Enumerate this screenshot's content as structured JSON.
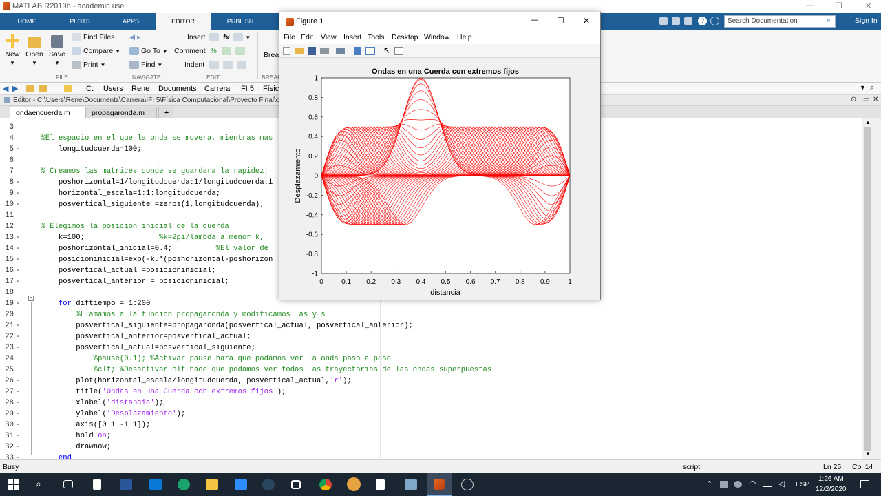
{
  "app": {
    "window_title": "MATLAB R2019b - academic use",
    "tabs": [
      "HOME",
      "PLOTS",
      "APPS",
      "EDITOR",
      "PUBLISH"
    ],
    "active_tab": "EDITOR",
    "search_placeholder": "Search Documentation",
    "sign_in": "Sign In"
  },
  "ribbon": {
    "file": {
      "new": "New",
      "open": "Open",
      "save": "Save",
      "find_files": "Find Files",
      "compare": "Compare",
      "print": "Print",
      "group": "FILE"
    },
    "navigate": {
      "go_to": "Go To",
      "find": "Find",
      "group": "NAVIGATE"
    },
    "edit": {
      "insert": "Insert",
      "comment": "Comment",
      "indent": "Indent",
      "group": "EDIT"
    },
    "breakpoints": {
      "label": "Break",
      "group": "BREAK"
    }
  },
  "address": {
    "parts": [
      "C:",
      "Users",
      "Rene",
      "Documents",
      "Carrera",
      "IFI 5",
      "Física"
    ]
  },
  "editor": {
    "path": "Editor - C:\\Users\\Rene\\Documents\\Carrera\\IFI 5\\Física Computacional\\Proyecto Final\\on",
    "files": [
      "ondaencuerda.m",
      "propagaronda.m"
    ],
    "lines": [
      {
        "n": "3",
        "t": ""
      },
      {
        "n": "4",
        "t": "    %El espacio en el que la onda se movera, mientras mas"
      },
      {
        "n": "5",
        "t": "        longitudcuerda=100;"
      },
      {
        "n": "6",
        "t": ""
      },
      {
        "n": "7",
        "t": "    % Creamos las matrices donde se guardara la rapidez;"
      },
      {
        "n": "8",
        "t": "        poshorizontal=1/longitudcuerda:1/longitudcuerda:1"
      },
      {
        "n": "9",
        "t": "        horizontal_escala=1:1:longitudcuerda;"
      },
      {
        "n": "10",
        "t": "        posvertical_siguiente =zeros(1,longitudcuerda);"
      },
      {
        "n": "11",
        "t": ""
      },
      {
        "n": "12",
        "t": "    % Elegimos la posicion inicial de la cuerda"
      },
      {
        "n": "13",
        "t": "        k=100;                 %k=2pi/lambda a menor k,"
      },
      {
        "n": "14",
        "t": "        poshorizontal_inicial=0.4;          %El valor de"
      },
      {
        "n": "15",
        "t": "        posicioninicial=exp(-k.*(poshorizontal-poshorizon"
      },
      {
        "n": "16",
        "t": "        posvertical_actual =posicioninicial;"
      },
      {
        "n": "17",
        "t": "        posvertical_anterior = posicioninicial;"
      },
      {
        "n": "18",
        "t": ""
      },
      {
        "n": "19",
        "t": "        for diftiempo = 1:200"
      },
      {
        "n": "20",
        "t": "            %Llamamos a la funcion propagaronda y modificamos las y s"
      },
      {
        "n": "21",
        "t": "            posvertical_siguiente=propagaronda(posvertical_actual, posvertical_anterior);"
      },
      {
        "n": "22",
        "t": "            posvertical_anterior=posvertical_actual;"
      },
      {
        "n": "23",
        "t": "            posvertical_actual=posvertical_siguiente;"
      },
      {
        "n": "24",
        "t": "                %pause(0.1); %Activar pause hara que podamos ver la onda paso a paso"
      },
      {
        "n": "25",
        "t": "                %clf; %Desactivar clf hace que podamos ver todas las trayectorias de las ondas superpuestas"
      },
      {
        "n": "26",
        "t": "            plot(horizontal_escala/longitudcuerda, posvertical_actual,'r');"
      },
      {
        "n": "27",
        "t": "            title('Ondas en una Cuerda con extremos fijos');"
      },
      {
        "n": "28",
        "t": "            xlabel('distancia');"
      },
      {
        "n": "29",
        "t": "            ylabel('Desplazamiento');"
      },
      {
        "n": "30",
        "t": "            axis([0 1 -1 1]);"
      },
      {
        "n": "31",
        "t": "            hold on;"
      },
      {
        "n": "32",
        "t": "            drawnow;"
      },
      {
        "n": "33",
        "t": "        end"
      }
    ]
  },
  "status": {
    "left": "Busy",
    "mode": "script",
    "ln": "Ln  25",
    "col": "Col  14"
  },
  "taskbar": {
    "lang": "ESP",
    "time": "1:26 AM",
    "date": "12/2/2020"
  },
  "figure": {
    "title": "Figure 1",
    "menu": [
      "File",
      "Edit",
      "View",
      "Insert",
      "Tools",
      "Desktop",
      "Window",
      "Help"
    ],
    "accent": "#ff0000",
    "chart_data": {
      "type": "line",
      "title": "Ondas en una Cuerda con extremos fijos",
      "xlabel": "distancia",
      "ylabel": "Desplazamiento",
      "xlim": [
        0,
        1
      ],
      "ylim": [
        -1,
        1
      ],
      "xticks": [
        "0",
        "0.1",
        "0.2",
        "0.3",
        "0.4",
        "0.5",
        "0.6",
        "0.7",
        "0.8",
        "0.9",
        "1"
      ],
      "yticks": [
        "1",
        "0.8",
        "0.6",
        "0.4",
        "0.2",
        "0",
        "-0.2",
        "-0.4",
        "-0.6",
        "-0.8",
        "-1"
      ],
      "series_note_k": 100,
      "initial_center": 0.4,
      "grid": false,
      "color": "#ff0000"
    }
  }
}
